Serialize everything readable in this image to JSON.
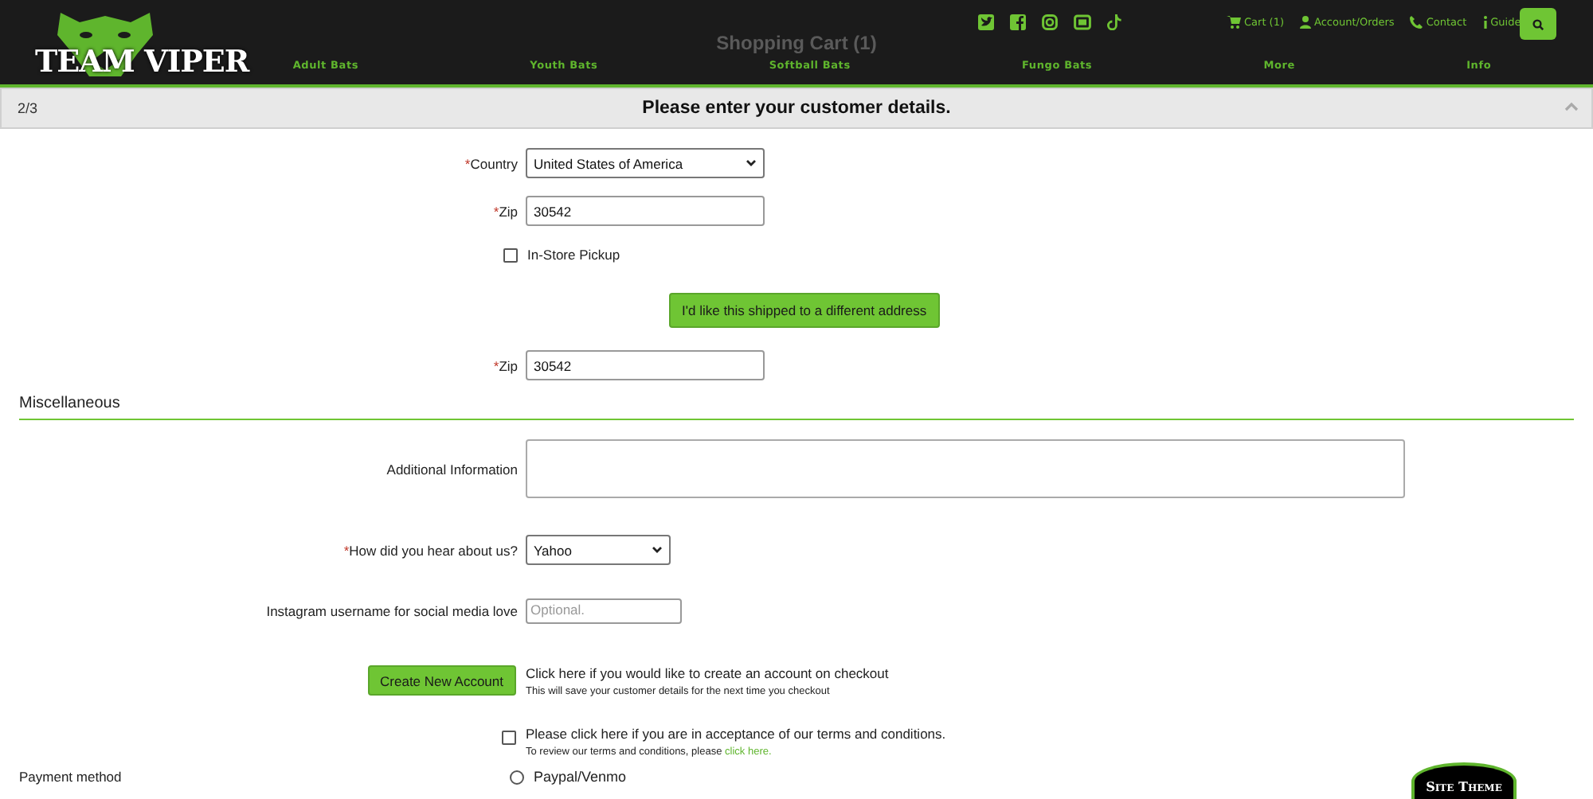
{
  "header": {
    "logo": "TEAM VIPER",
    "background_title": "Shopping Cart (1)",
    "links": [
      {
        "kind": "cart",
        "label": "Cart (1)"
      },
      {
        "kind": "account",
        "label": "Account/Orders"
      },
      {
        "kind": "phone",
        "label": "Contact"
      },
      {
        "kind": "info",
        "label": "Guide"
      }
    ],
    "nav": [
      "Adult Bats",
      "Youth Bats",
      "Softball Bats",
      "Fungo Bats",
      "More",
      "Info"
    ]
  },
  "step": {
    "counter": "2/3",
    "title": "Please enter your customer details."
  },
  "fields": [
    {
      "kind": "select",
      "label": "Country",
      "mark": "*",
      "value": "United States of America"
    },
    {
      "kind": "input",
      "label": "Zip",
      "mark": "*",
      "value": "30542"
    },
    {
      "kind": "checkbox",
      "label": "In-Store Pickup",
      "checked": false
    },
    {
      "kind": "button",
      "label": "I'd like this shipped to a different address"
    },
    {
      "kind": "input",
      "label": "Zip",
      "mark": "*",
      "value": "30542"
    }
  ],
  "section": "Miscellaneous",
  "misc_fields": [
    {
      "kind": "textarea",
      "label": "Additional Information"
    },
    {
      "kind": "select",
      "label": "How did you hear about us?",
      "mark": "*",
      "value": "Yahoo"
    },
    {
      "kind": "smallarea",
      "label": "Instagram username for social media love",
      "placeholder": "Optional."
    }
  ],
  "account": {
    "button": "Create New Account",
    "text": "Click here if you would like to create an account on checkout",
    "note": "This will save your customer details for the next time you checkout"
  },
  "terms": {
    "checked": false,
    "text": "Please click here if you are in acceptance of our terms and conditions.",
    "note": "To review our terms and conditions, please",
    "link": "click here."
  },
  "payment": {
    "label": "Payment method",
    "options": [
      {
        "label": "Paypal/Venmo",
        "selected": false
      }
    ]
  },
  "theme_tab": "Site Theme"
}
